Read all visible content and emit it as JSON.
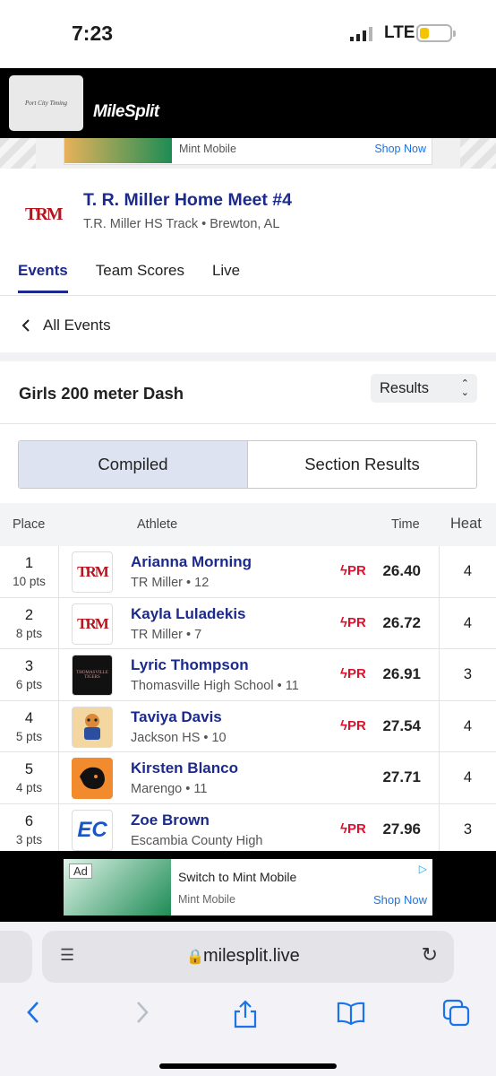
{
  "status_bar": {
    "time": "7:23",
    "network": "LTE",
    "battery_color": "#f5c400"
  },
  "header": {
    "sponsor_text": "Port City Timing",
    "logo": "MileSplit"
  },
  "top_ad": {
    "brand": "Mint Mobile",
    "cta": "Shop Now"
  },
  "meet": {
    "logo_text": "TRM",
    "title": "T. R. Miller Home Meet #4",
    "subtitle": "T.R. Miller HS Track • Brewton, AL",
    "tabs": [
      "Events",
      "Team Scores",
      "Live"
    ],
    "active_tab": "Events"
  },
  "nav": {
    "back_label": "All Events"
  },
  "event": {
    "name": "Girls 200 meter Dash",
    "view_select": "Results"
  },
  "segments": {
    "compiled": "Compiled",
    "section": "Section Results"
  },
  "table": {
    "headers": {
      "place": "Place",
      "athlete": "Athlete",
      "time": "Time",
      "heat": "Heat"
    },
    "rows": [
      {
        "place": "1",
        "pts": "10 pts",
        "logo": "TRM",
        "athlete": "Arianna Morning",
        "team": "TR Miller • 12",
        "pr": "PR",
        "time": "26.40",
        "heat": "4"
      },
      {
        "place": "2",
        "pts": "8 pts",
        "logo": "TRM",
        "athlete": "Kayla Luladekis",
        "team": "TR Miller • 7",
        "pr": "PR",
        "time": "26.72",
        "heat": "4"
      },
      {
        "place": "3",
        "pts": "6 pts",
        "logo": "THOMASVILLE TIGERS",
        "athlete": "Lyric Thompson",
        "team": "Thomasville High School • 11",
        "pr": "PR",
        "time": "26.91",
        "heat": "3"
      },
      {
        "place": "4",
        "pts": "5 pts",
        "logo": "",
        "athlete": "Taviya Davis",
        "team": "Jackson HS • 10",
        "pr": "PR",
        "time": "27.54",
        "heat": "4"
      },
      {
        "place": "5",
        "pts": "4 pts",
        "logo": "",
        "athlete": "Kirsten Blanco",
        "team": "Marengo • 11",
        "pr": "",
        "time": "27.71",
        "heat": "4"
      },
      {
        "place": "6",
        "pts": "3 pts",
        "logo": "EC",
        "athlete": "Zoe Brown",
        "team": "Escambia County High",
        "pr": "PR",
        "time": "27.96",
        "heat": "3"
      }
    ]
  },
  "bottom_ad": {
    "tag": "Ad",
    "headline": "Switch to Mint Mobile",
    "brand": "Mint Mobile",
    "cta": "Shop Now"
  },
  "browser": {
    "url": "milesplit.live"
  }
}
